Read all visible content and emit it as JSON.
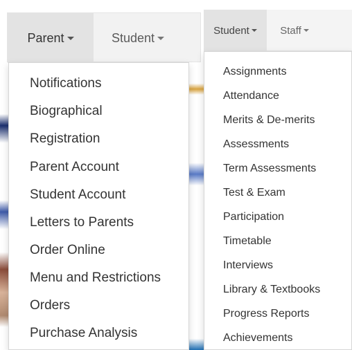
{
  "left_nav": {
    "tabs": [
      {
        "label": "Parent",
        "active": true
      },
      {
        "label": "Student",
        "active": false
      }
    ],
    "dropdown": {
      "items": [
        {
          "label": "Notifications"
        },
        {
          "label": "Biographical"
        },
        {
          "label": "Registration"
        },
        {
          "label": "Parent Account"
        },
        {
          "label": "Student Account"
        },
        {
          "label": "Letters to Parents"
        },
        {
          "label": "Order Online"
        },
        {
          "label": "Menu and Restrictions"
        },
        {
          "label": "Orders"
        },
        {
          "label": "Purchase Analysis"
        }
      ]
    }
  },
  "right_nav": {
    "tabs": [
      {
        "label": "Student",
        "active": true
      },
      {
        "label": "Staff",
        "active": false
      }
    ],
    "dropdown": {
      "items": [
        {
          "label": "Assignments"
        },
        {
          "label": "Attendance"
        },
        {
          "label": "Merits & De-merits"
        },
        {
          "label": "Assessments"
        },
        {
          "label": "Term Assessments"
        },
        {
          "label": "Test & Exam"
        },
        {
          "label": "Participation"
        },
        {
          "label": "Timetable"
        },
        {
          "label": "Interviews"
        },
        {
          "label": "Library & Textbooks"
        },
        {
          "label": "Progress Reports"
        },
        {
          "label": "Achievements"
        }
      ]
    }
  },
  "colors": {
    "navbar_bg": "#f2f2f2",
    "active_tab_bg": "#e3e3e3",
    "menu_text": "#333333",
    "dropdown_border": "#d6d6d6"
  },
  "icons": {
    "dropdown_caret": "caret-down-icon"
  }
}
